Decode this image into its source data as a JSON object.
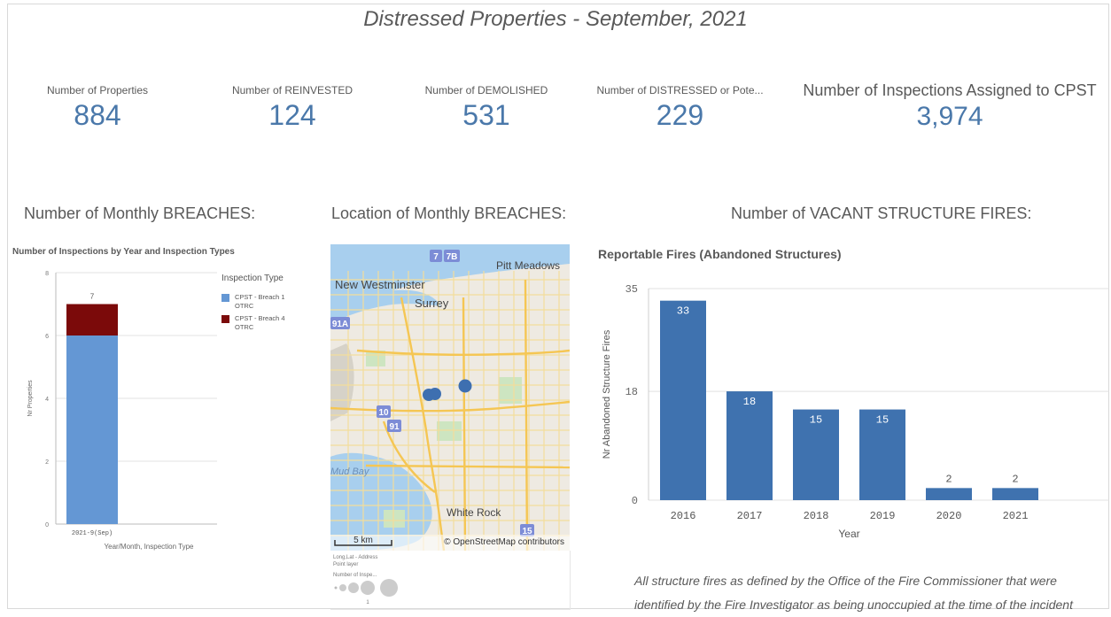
{
  "title": "Distressed Properties - September, 2021",
  "kpis": [
    {
      "label": "Number of Properties",
      "value": "884"
    },
    {
      "label": "Number of REINVESTED",
      "value": "124"
    },
    {
      "label": "Number of DEMOLISHED",
      "value": "531"
    },
    {
      "label": "Number of DISTRESSED or Pote...",
      "value": "229"
    },
    {
      "label": "Number of Inspections Assigned to CPST",
      "value": "3,974"
    }
  ],
  "sections": {
    "breaches": "Number of Monthly BREACHES:",
    "location": "Location of Monthly BREACHES:",
    "fires": "Number of VACANT STRUCTURE FIRES:"
  },
  "map": {
    "labels": {
      "pitt": "Pitt Meadows",
      "newwest": "New Westminster",
      "surrey": "Surrey",
      "mudbay": "Mud Bay",
      "whiterock": "White Rock",
      "r7": "7",
      "r7b": "7B",
      "r91a": "91A",
      "r10": "10",
      "r91": "91",
      "r15": "15"
    },
    "scale": "5 km",
    "attribution": "© OpenStreetMap contributors",
    "legend_line1": "Long,Lat - Address",
    "legend_line2": "Point layer",
    "legend_line3": "Number of Inspe...",
    "legend_tick": "1",
    "colors": {
      "water": "#a8cfee",
      "land": "#eeeae2",
      "road": "#f5d67a",
      "point": "#3e6fb0"
    }
  },
  "fires_note": "All structure fires as defined by the Office of the Fire Commissioner that were identified by the Fire Investigator as being unoccupied at the time of the incident",
  "chart_data": [
    {
      "type": "bar",
      "stacked": true,
      "title": "Number of Inspections by Year and Inspection Types",
      "xlabel": "Year/Month, Inspection Type",
      "ylabel": "Nr Properties",
      "ylim": [
        0,
        8
      ],
      "yticks": [
        0,
        2,
        4,
        6,
        8
      ],
      "categories": [
        "2021-9(Sep)"
      ],
      "total_labels": [
        "7"
      ],
      "legend_title": "Inspection Type",
      "legend_position": "right",
      "series": [
        {
          "name": "CPST - Breach 1 OTRC",
          "values": [
            6
          ],
          "color": "#6497d4"
        },
        {
          "name": "CPST - Breach 4 OTRC",
          "values": [
            1
          ],
          "color": "#7b0a0a"
        }
      ]
    },
    {
      "type": "bar",
      "title": "Reportable Fires (Abandoned Structures)",
      "xlabel": "Year",
      "ylabel": "Nr Abandoned Structure Fires",
      "ylim": [
        0,
        35
      ],
      "yticks": [
        0,
        18,
        35
      ],
      "grid": true,
      "categories": [
        "2016",
        "2017",
        "2018",
        "2019",
        "2020",
        "2021"
      ],
      "values": [
        33,
        18,
        15,
        15,
        2,
        2
      ],
      "color": "#3f72af"
    }
  ]
}
